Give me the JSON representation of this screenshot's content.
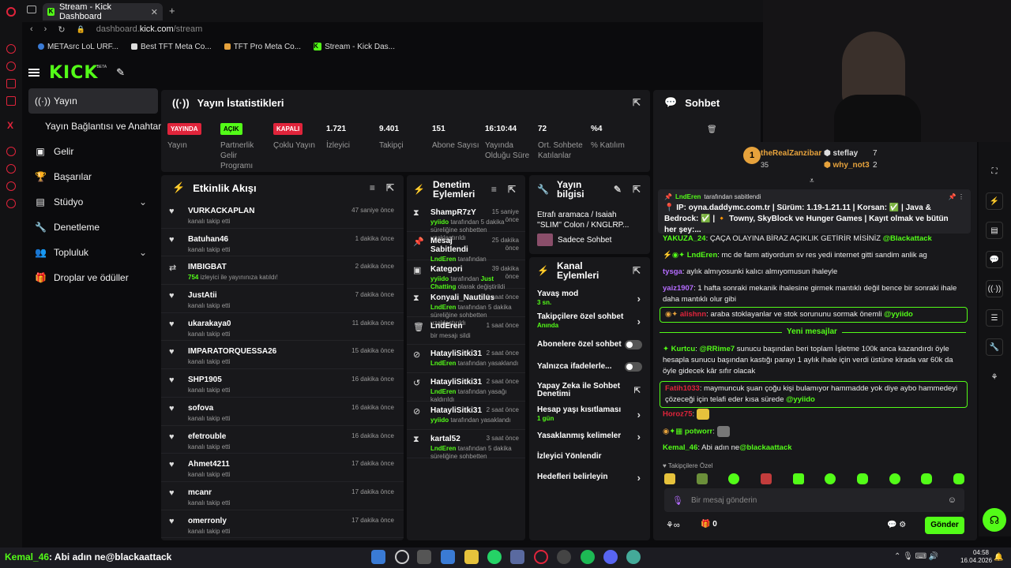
{
  "browser": {
    "tab_title": "Stream - Kick Dashboard",
    "url_host": "dashboard.",
    "url_domain": "kick.com",
    "url_path": "/stream",
    "bookmarks": [
      "METAsrc LoL URF...",
      "Best TFT Meta Co...",
      "TFT Pro Meta Co...",
      "Stream - Kick Das..."
    ]
  },
  "header": {
    "logo": "KICK",
    "beta": "BETA"
  },
  "sidebar": {
    "items": [
      {
        "label": "Yayın",
        "icon": "broadcast-icon"
      },
      {
        "label": "Yayın Bağlantısı ve Anahtarı",
        "icon": ""
      },
      {
        "label": "Gelir",
        "icon": "revenue-icon"
      },
      {
        "label": "Başarılar",
        "icon": "trophy-icon"
      },
      {
        "label": "Stüdyo",
        "icon": "studio-icon"
      },
      {
        "label": "Denetleme",
        "icon": "wrench-icon"
      },
      {
        "label": "Topluluk",
        "icon": "community-icon"
      },
      {
        "label": "Droplar ve ödüller",
        "icon": "gift-icon"
      }
    ]
  },
  "stats": {
    "title": "Yayın İstatistikleri",
    "items": [
      {
        "value": "YAYINDA",
        "label": "Yayın",
        "badge": "red"
      },
      {
        "value": "AÇIK",
        "label": "Partnerlik Gelir Programı",
        "badge": "green"
      },
      {
        "value": "KAPALI",
        "label": "Çoklu Yayın",
        "badge": "red"
      },
      {
        "value": "1.721",
        "label": "İzleyici",
        "badge": ""
      },
      {
        "value": "9.401",
        "label": "Takipçi",
        "badge": ""
      },
      {
        "value": "151",
        "label": "Abone Sayısı",
        "badge": ""
      },
      {
        "value": "16:10:44",
        "label": "Yayında Olduğu Süre",
        "badge": ""
      },
      {
        "value": "72",
        "label": "Ort. Sohbete Katılanlar",
        "badge": ""
      },
      {
        "value": "%4",
        "label": "% Katılım",
        "badge": ""
      }
    ]
  },
  "activity": {
    "title": "Etkinlik Akışı",
    "items": [
      {
        "name": "VURKACKAPLAN",
        "sub": "kanalı takip etti",
        "time": "47 saniye önce",
        "icon": "heart-icon"
      },
      {
        "name": "Batuhan46",
        "sub": "kanalı takip etti",
        "time": "1 dakika önce",
        "icon": "heart-icon"
      },
      {
        "name": "IMBIGBAT",
        "sub_strong": "754",
        "sub": "izleyici ile yayınınıza katıldı!",
        "time": "2 dakika önce",
        "icon": "raid-icon"
      },
      {
        "name": "JustAtii",
        "sub": "kanalı takip etti",
        "time": "7 dakika önce",
        "icon": "heart-icon"
      },
      {
        "name": "ukarakaya0",
        "sub": "kanalı takip etti",
        "time": "11 dakika önce",
        "icon": "heart-icon"
      },
      {
        "name": "IMPARATORQUESSA26",
        "sub": "kanalı takip etti",
        "time": "15 dakika önce",
        "icon": "heart-icon"
      },
      {
        "name": "SHP1905",
        "sub": "kanalı takip etti",
        "time": "16 dakika önce",
        "icon": "heart-icon"
      },
      {
        "name": "sofova",
        "sub": "kanalı takip etti",
        "time": "16 dakika önce",
        "icon": "heart-icon"
      },
      {
        "name": "efetrouble",
        "sub": "kanalı takip etti",
        "time": "16 dakika önce",
        "icon": "heart-icon"
      },
      {
        "name": "Ahmet4211",
        "sub": "kanalı takip etti",
        "time": "17 dakika önce",
        "icon": "heart-icon"
      },
      {
        "name": "mcanr",
        "sub": "kanalı takip etti",
        "time": "17 dakika önce",
        "icon": "heart-icon"
      },
      {
        "name": "omerronly",
        "sub": "kanalı takip etti",
        "time": "17 dakika önce",
        "icon": "heart-icon"
      }
    ]
  },
  "moderation": {
    "title": "Denetim Eylemleri",
    "items": [
      {
        "name": "ShampR7zY",
        "time": "15 saniye önce",
        "by": "yyiido",
        "sub": "tarafından 5 dakika süreliğine sohbetten uzaklaştırıldı",
        "icon": "hourglass-icon"
      },
      {
        "name": "Mesaj Sabitlendi",
        "time": "25 dakika önce",
        "by": "LndEren",
        "sub": "tarafından",
        "icon": "pin-icon"
      },
      {
        "name": "Kategori",
        "time": "39 dakika önce",
        "by": "yyiido",
        "sub": "tarafından",
        "sub2": "Just Chatting",
        "sub3": "olarak değiştirildi",
        "icon": "category-icon"
      },
      {
        "name": "Konyali_Nautilus",
        "time": "1 saat önce",
        "by": "LndEren",
        "sub": "tarafından 5 dakika süreliğine sohbetten uzaklaştırıldı",
        "icon": "hourglass-icon"
      },
      {
        "name": "LndEren",
        "time": "1 saat önce",
        "by": "",
        "sub": "bir mesajı sildi",
        "icon": "trash-icon"
      },
      {
        "name": "HatayliSitki31",
        "time": "2 saat önce",
        "by": "LndEren",
        "sub": "tarafından yasaklandı",
        "icon": "ban-icon"
      },
      {
        "name": "HatayliSitki31",
        "time": "2 saat önce",
        "by": "LndEren",
        "sub": "tarafından yasağı kaldırıldı",
        "icon": "undo-icon"
      },
      {
        "name": "HatayliSitki31",
        "time": "2 saat önce",
        "by": "yyiido",
        "sub": "tarafından yasaklandı",
        "icon": "ban-icon"
      },
      {
        "name": "kartal52",
        "time": "3 saat önce",
        "by": "LndEren",
        "sub": "tarafından 5 dakika süreliğine sohbetten",
        "icon": "hourglass-icon"
      }
    ]
  },
  "streaminfo": {
    "title": "Yayın bilgisi",
    "text": "Etrafı aramaca / Isaiah ''SLIM'' Colon / KNGLRP...",
    "chat_mode": "Sadece Sohbet"
  },
  "channel_actions": {
    "title": "Kanal Eylemleri",
    "items": [
      {
        "label": "Yavaş mod",
        "sub": "3 sn.",
        "control": "chevron"
      },
      {
        "label": "Takipçilere özel sohbet",
        "sub": "Anında",
        "control": "chevron"
      },
      {
        "label": "Abonelere özel sohbet",
        "sub": "",
        "control": "toggle"
      },
      {
        "label": "Yalnızca ifadelerle...",
        "sub": "",
        "control": "toggle"
      },
      {
        "label": "Yapay Zeka ile Sohbet Denetimi",
        "sub": "",
        "control": "link"
      },
      {
        "label": "Hesap yaşı kısıtlaması",
        "sub": "1 gün",
        "control": "chevron"
      },
      {
        "label": "Yasaklanmış kelimeler",
        "sub": "",
        "control": "chevron"
      },
      {
        "label": "İzleyici Yönlendir",
        "sub": "",
        "control": ""
      },
      {
        "label": "Hedefleri belirleyin",
        "sub": "",
        "control": "chevron"
      }
    ]
  },
  "chat": {
    "title": "Sohbet",
    "leaderboard": {
      "first_name": "theRealZanzibar",
      "first_value": "35",
      "second_name": "steflay",
      "second_value": "7",
      "third_name": "why_not3",
      "third_value": "2"
    },
    "pinned": {
      "by": "LndEren",
      "by_suffix": "tarafından sabitlendi",
      "text": "📍 IP: oyna.daddymc.com.tr | Sürüm: 1.19-1.21.11 | Korsan: ✅ | Java & Bedrock: ✅ | 🔸 Towny, SkyBlock ve Hunger Games | Kayıt olmak ve bütün her şey:..."
    },
    "messages": [
      {
        "user": "YAKUZA_24",
        "color": "#53fc18",
        "text": "ÇAÇA OLAYINA BİRAZ AÇIKLIK GETİRİR MİSİNİZ",
        "mention": "@Blackattack"
      },
      {
        "user": "LndEren",
        "color": "#53fc18",
        "text": "mc de farm atiyordum sv res yedi internet gitti sandim anlik ag",
        "mention": ""
      },
      {
        "user": "tysga",
        "color": "#b56cff",
        "text": "aylık almıyosunki kalıcı almıyomusun ihaleyle",
        "mention": ""
      },
      {
        "user": "yaiz1907",
        "color": "#b56cff",
        "text": "1 hafta sonraki mekanik ihalesine girmek mantıklı değil bence bir sonraki ihale daha mantıklı olur gibi",
        "mention": ""
      },
      {
        "user": "alishnn",
        "color": "#e0243b",
        "text": "araba stoklayanlar ve stok sorununu sormak önemli",
        "mention": "@yyiido"
      },
      {
        "user": "Kurtcu",
        "color": "#53fc18",
        "text": "",
        "mention": "@RRime7",
        "text2": "sunucu başından beri toplam İşletme 100k anca kazandırdı öyle hesapla sunucu başından kastığı parayı 1 aylık ihale için verdi üstüne kirada var 60k da öyle gidecek kâr sıfır olacak"
      },
      {
        "user": "Fatih1033",
        "color": "#e0243b",
        "text": "maymuncuk şuan çoğu kişi bulamıyor hammadde yok diye aybo hammedeyi çözeceği için telafi eder kısa sürede",
        "mention": "@yyiido"
      },
      {
        "user": "Horoz75",
        "color": "#e0243b",
        "text": "",
        "mention": ""
      },
      {
        "user": "potworr",
        "color": "#53fc18",
        "text": "",
        "mention": ""
      },
      {
        "user": "Kemal_46",
        "color": "#53fc18",
        "text": "Abi adın ne",
        "mention": "@blackaattack"
      }
    ],
    "new_messages": "Yeni mesajlar",
    "emote_label": "Takipçilere Özel",
    "input_placeholder": "Bir mesaj gönderin",
    "points": "0",
    "send_label": "Gönder"
  },
  "overlay": {
    "caption_user": "Kemal_46",
    "caption_text": ": Abi adın ne@blackaattack"
  },
  "taskbar": {
    "time": "04:58",
    "date": "16.04.2026"
  },
  "colors": {
    "accent": "#53fc18",
    "live_red": "#e0243b",
    "panel": "#18181b",
    "bg": "#0b0b0d"
  }
}
